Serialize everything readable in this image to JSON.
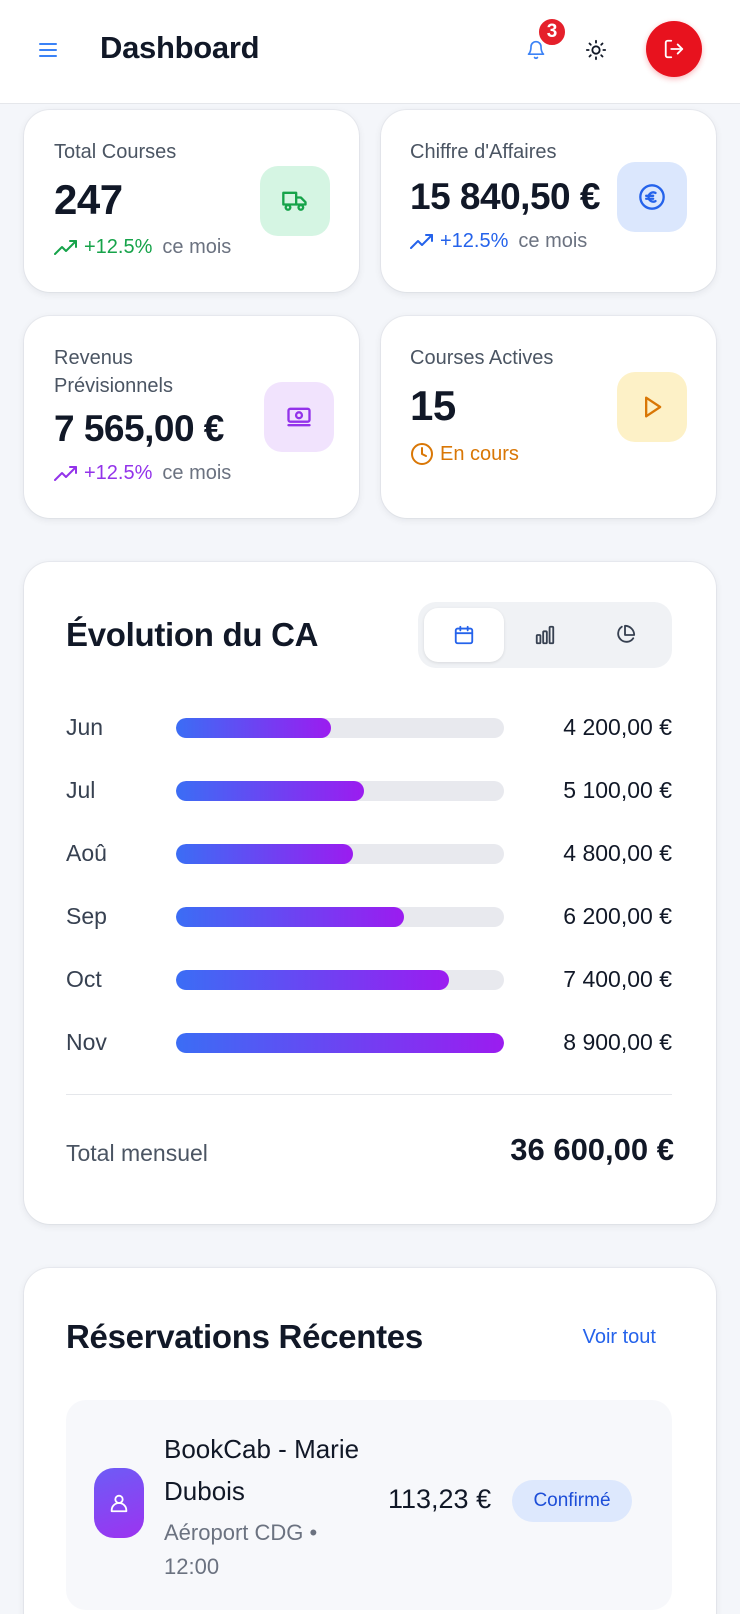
{
  "header": {
    "title": "Dashboard",
    "notification_count": "3",
    "icons": {
      "menu": "menu-icon",
      "bell": "bell-icon",
      "theme": "sun-icon",
      "logout": "logout-icon"
    },
    "logout_color": "#e8121e"
  },
  "stats": {
    "total_courses": {
      "label": "Total Courses",
      "value": "247",
      "trend_pct": "+12.5%",
      "trend_suffix": "ce mois",
      "icon": "truck-icon",
      "accent": "#16a34a"
    },
    "chiffre_affaires": {
      "label": "Chiffre d'Affaires",
      "value": "15 840,50 €",
      "trend_pct": "+12.5%",
      "trend_suffix": "ce mois",
      "icon": "euro-icon",
      "accent": "#2563eb"
    },
    "revenus_previsionnels": {
      "label": "Revenus Prévisionnels",
      "value": "7 565,00 €",
      "trend_pct": "+12.5%",
      "trend_suffix": "ce mois",
      "icon": "banknote-icon",
      "accent": "#9333ea"
    },
    "courses_actives": {
      "label": "Courses Actives",
      "value": "15",
      "status": "En cours",
      "icon": "play-icon",
      "accent": "#d97706"
    }
  },
  "revenue_chart": {
    "title": "Évolution du CA",
    "view_icons": [
      "calendar-icon",
      "bar-chart-icon",
      "pie-chart-icon"
    ],
    "total_label": "Total mensuel",
    "total_value": "36 600,00 €"
  },
  "chart_data": {
    "type": "bar",
    "orientation": "horizontal",
    "categories": [
      "Jun",
      "Jul",
      "Aoû",
      "Sep",
      "Oct",
      "Nov"
    ],
    "values": [
      4200,
      5100,
      4800,
      6200,
      7400,
      8900
    ],
    "value_labels": [
      "4 200,00 €",
      "5 100,00 €",
      "4 800,00 €",
      "6 200,00 €",
      "7 400,00 €",
      "8 900,00 €"
    ],
    "xlim": [
      0,
      8900
    ],
    "title": "Évolution du CA",
    "grid": false,
    "bar_gradient": [
      "#3b6df5",
      "#9b1cf0"
    ]
  },
  "reservations": {
    "title": "Réservations Récentes",
    "see_all": "Voir tout",
    "items": [
      {
        "name": "BookCab - Marie Dubois",
        "meta": "Aéroport CDG • 12:00",
        "price": "113,23 €",
        "status": "Confirmé",
        "icon": "user-icon"
      }
    ]
  }
}
